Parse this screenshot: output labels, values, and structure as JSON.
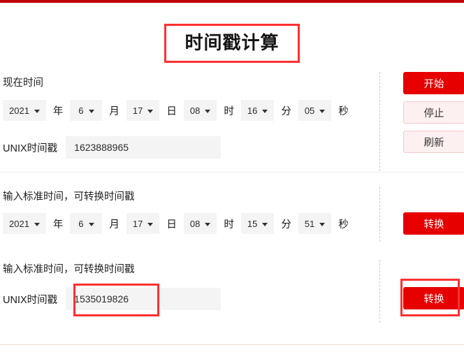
{
  "page": {
    "title": "时间戳计算",
    "accent_color": "#e60000",
    "top_bar_color": "#c00000",
    "highlight_color": "#ff3030",
    "field_bg_color": "#f4f4f4"
  },
  "section_current": {
    "label": "现在时间",
    "date_row": {
      "year": {
        "value": "2021",
        "unit": "年"
      },
      "month": {
        "value": "6",
        "unit": "月"
      },
      "day": {
        "value": "17",
        "unit": "日"
      },
      "hour": {
        "value": "08",
        "unit": "时"
      },
      "minute": {
        "value": "16",
        "unit": "分"
      },
      "second": {
        "value": "05",
        "unit": "秒"
      }
    },
    "timestamp": {
      "label": "UNIX时间戳",
      "value": "1623888965",
      "placeholder": ""
    },
    "buttons": {
      "start": "开始",
      "stop": "停止",
      "refresh": "刷新"
    }
  },
  "section_to_timestamp": {
    "label": "输入标准时间，可转换时间戳",
    "date_row": {
      "year": {
        "value": "2021",
        "unit": "年"
      },
      "month": {
        "value": "6",
        "unit": "月"
      },
      "day": {
        "value": "17",
        "unit": "日"
      },
      "hour": {
        "value": "08",
        "unit": "时"
      },
      "minute": {
        "value": "15",
        "unit": "分"
      },
      "second": {
        "value": "51",
        "unit": "秒"
      }
    },
    "buttons": {
      "convert": "转换"
    }
  },
  "section_from_timestamp": {
    "label": "输入标准时间，可转换时间戳",
    "timestamp": {
      "label": "UNIX时间戳",
      "value": "1535019826",
      "placeholder": ""
    },
    "buttons": {
      "convert": "转换"
    }
  },
  "icons": {
    "caret_down": "chevron-down-icon"
  }
}
